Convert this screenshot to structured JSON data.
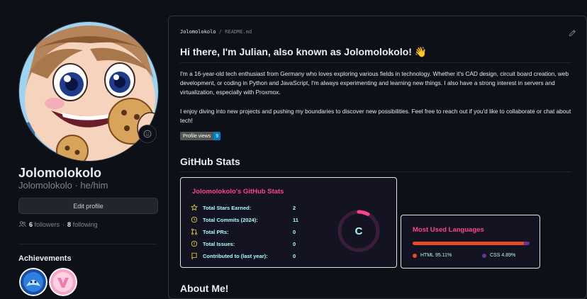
{
  "profile": {
    "display_name": "Jolomolokolo",
    "username": "Jolomolokolo · he/him",
    "edit_button": "Edit profile",
    "followers_count": "6",
    "followers_label": "followers",
    "separator": "·",
    "following_count": "8",
    "following_label": "following",
    "achievements_title": "Achievements"
  },
  "readme": {
    "path_user": "Jolomolokolo",
    "path_sep": "/",
    "path_file": "README.md",
    "heading": "Hi there, I'm Julian, also known as Jolomolokolo! 👋",
    "paragraph1": "I'm a 16-year-old tech enthusiast from Germany who loves exploring various fields in technology. Whether it's CAD design, circuit board creation, web development, or coding in Python and JavaScript, I'm always experimenting and learning new things. I also have a strong interest in servers and virtualization, especially with Proxmox.",
    "paragraph2": "I enjoy diving into new projects and pushing my boundaries to discover new possibilities. Feel free to reach out if you'd like to collaborate or chat about tech!",
    "views_label": "Profile views",
    "views_count": "9",
    "stats_heading": "GitHub Stats",
    "about_heading": "About Me!"
  },
  "stats": {
    "title": "Jolomolokolo's GitHub Stats",
    "rows": [
      {
        "label": "Total Stars Earned:",
        "value": "2",
        "icon": "star-icon"
      },
      {
        "label": "Total Commits (2024):",
        "value": "11",
        "icon": "history-icon"
      },
      {
        "label": "Total PRs:",
        "value": "0",
        "icon": "pull-request-icon"
      },
      {
        "label": "Total Issues:",
        "value": "0",
        "icon": "issue-icon"
      },
      {
        "label": "Contributed to (last year):",
        "value": "0",
        "icon": "repo-icon"
      }
    ],
    "rank": "C",
    "rank_progress": 0.08
  },
  "languages": {
    "title": "Most Used Languages",
    "items": [
      {
        "name": "HTML",
        "percent": "95.11%",
        "value": 95.11,
        "color": "#e34c26"
      },
      {
        "name": "CSS",
        "percent": "4.89%",
        "value": 4.89,
        "color": "#663399"
      }
    ]
  },
  "colors": {
    "accent": "#fe428e",
    "stat_text": "#a9fef7",
    "icon": "#f8d847"
  }
}
